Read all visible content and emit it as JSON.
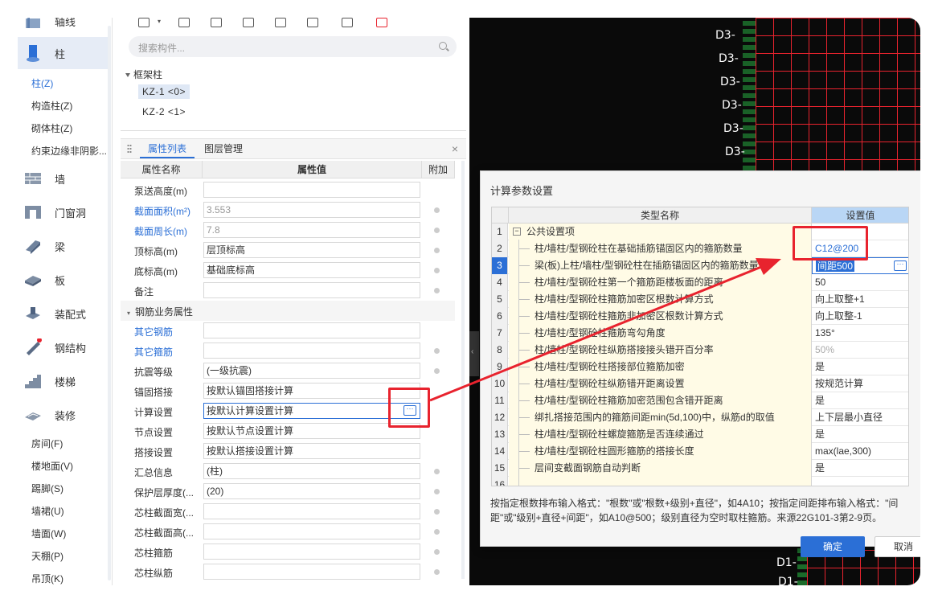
{
  "leftnav": {
    "categories": [
      {
        "label": "轴线",
        "icon": "axis-icon"
      },
      {
        "label": "柱",
        "icon": "column-icon"
      },
      {
        "label": "墙",
        "icon": "wall-icon"
      },
      {
        "label": "门窗洞",
        "icon": "door-window-icon"
      },
      {
        "label": "梁",
        "icon": "beam-icon"
      },
      {
        "label": "板",
        "icon": "slab-icon"
      },
      {
        "label": "装配式",
        "icon": "prefab-icon"
      },
      {
        "label": "钢结构",
        "icon": "steel-structure-icon"
      },
      {
        "label": "楼梯",
        "icon": "stairs-icon"
      },
      {
        "label": "装修",
        "icon": "decoration-icon"
      }
    ],
    "column_subitems": [
      "柱(Z)",
      "构造柱(Z)",
      "砌体柱(Z)",
      "约束边缘非阴影..."
    ],
    "decoration_subitems": [
      "房间(F)",
      "楼地面(V)",
      "踢脚(S)",
      "墙裙(U)",
      "墙面(W)",
      "天棚(P)",
      "吊顶(K)"
    ]
  },
  "middle": {
    "search_placeholder": "搜索构件...",
    "tree_group": "框架柱",
    "tree_items": [
      "KZ-1 <0>",
      "KZ-2 <1>"
    ],
    "tabs": {
      "properties": "属性列表",
      "layers": "图层管理",
      "close": "×"
    },
    "columns": {
      "name": "属性名称",
      "value": "属性值",
      "extra": "附加"
    },
    "rows": [
      {
        "name": "泵送高度(m)",
        "value": ""
      },
      {
        "name": "截面面积(m²)",
        "value": "3.553"
      },
      {
        "name": "截面周长(m)",
        "value": "7.8"
      },
      {
        "name": "顶标高(m)",
        "value": "层顶标高"
      },
      {
        "name": "底标高(m)",
        "value": "基础底标高"
      },
      {
        "name": "备注",
        "value": ""
      },
      {
        "name": "钢筋业务属性",
        "value": ""
      },
      {
        "name": "其它钢筋",
        "value": ""
      },
      {
        "name": "其它箍筋",
        "value": ""
      },
      {
        "name": "抗震等级",
        "value": "(一级抗震)"
      },
      {
        "name": "锚固搭接",
        "value": "按默认锚固搭接计算"
      },
      {
        "name": "计算设置",
        "value": "按默认计算设置计算"
      },
      {
        "name": "节点设置",
        "value": "按默认节点设置计算"
      },
      {
        "name": "搭接设置",
        "value": "按默认搭接设置计算"
      },
      {
        "name": "汇总信息",
        "value": "(柱)"
      },
      {
        "name": "保护层厚度(...",
        "value": "(20)"
      },
      {
        "name": "芯柱截面宽(...",
        "value": ""
      },
      {
        "name": "芯柱截面高(...",
        "value": ""
      },
      {
        "name": "芯柱箍筋",
        "value": ""
      },
      {
        "name": "芯柱纵筋",
        "value": ""
      }
    ],
    "more_label": "···"
  },
  "cad": {
    "labels": [
      "D3-",
      "D3-",
      "D3-",
      "D3-",
      "D3-",
      "D3-",
      "D1-",
      "D1-"
    ],
    "colors": {
      "grid": "#e8232e",
      "background": "#0a0a0a",
      "rebar": "#1b6b2a"
    }
  },
  "dialog": {
    "title": "计算参数设置",
    "columns": {
      "type_name": "类型名称",
      "value": "设置值"
    },
    "rows": [
      {
        "idx": "1",
        "name": "公共设置项",
        "value": ""
      },
      {
        "idx": "2",
        "name": "柱/墙柱/型钢砼柱在基础插筋锚固区内的箍筋数量",
        "value": "C12@200"
      },
      {
        "idx": "3",
        "name": "梁(板)上柱/墙柱/型钢砼柱在插筋锚固区内的箍筋数量",
        "value": "间距500"
      },
      {
        "idx": "4",
        "name": "柱/墙柱/型钢砼柱第一个箍筋距楼板面的距离",
        "value": "50"
      },
      {
        "idx": "5",
        "name": "柱/墙柱/型钢砼柱箍筋加密区根数计算方式",
        "value": "向上取整+1"
      },
      {
        "idx": "6",
        "name": "柱/墙柱/型钢砼柱箍筋非加密区根数计算方式",
        "value": "向上取整-1"
      },
      {
        "idx": "7",
        "name": "柱/墙柱/型钢砼柱箍筋弯勾角度",
        "value": "135°"
      },
      {
        "idx": "8",
        "name": "柱/墙柱/型钢砼柱纵筋搭接接头错开百分率",
        "value": "50%"
      },
      {
        "idx": "9",
        "name": "柱/墙柱/型钢砼柱搭接部位箍筋加密",
        "value": "是"
      },
      {
        "idx": "10",
        "name": "柱/墙柱/型钢砼柱纵筋错开距离设置",
        "value": "按规范计算"
      },
      {
        "idx": "11",
        "name": "柱/墙柱/型钢砼柱箍筋加密范围包含错开距离",
        "value": "是"
      },
      {
        "idx": "12",
        "name": "绑扎搭接范围内的箍筋间距min(5d,100)中，纵筋d的取值",
        "value": "上下层最小直径"
      },
      {
        "idx": "13",
        "name": "柱/墙柱/型钢砼柱螺旋箍筋是否连续通过",
        "value": "是"
      },
      {
        "idx": "14",
        "name": "柱/墙柱/型钢砼柱圆形箍筋的搭接长度",
        "value": "max(lae,300)"
      },
      {
        "idx": "15",
        "name": "层间变截面钢筋自动判断",
        "value": "是"
      }
    ],
    "hint": "按指定根数排布输入格式：\"根数\"或\"根数+级别+直径\"，如4A10；按指定间距排布输入格式：\"间距\"或\"级别+直径+间距\"，如A10@500；级别直径为空时取柱箍筋。来源22G101-3第2-9页。",
    "ok": "确定",
    "cancel": "取消"
  }
}
